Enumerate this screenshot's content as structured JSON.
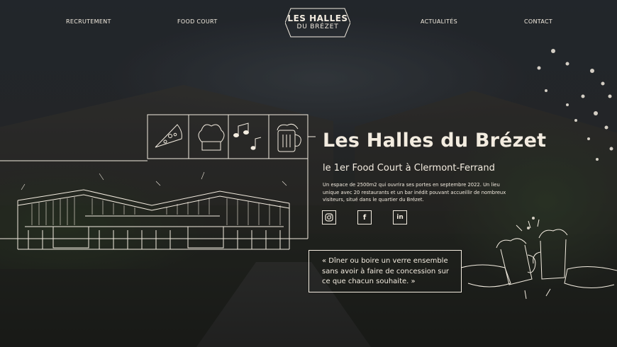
{
  "nav": {
    "recrutement": "RECRUTEMENT",
    "food_court": "FOOD COURT",
    "actualites": "ACTUALITÉS",
    "contact": "CONTACT"
  },
  "logo": {
    "line1": "LES HALLES",
    "line2": "DU BRÉZET"
  },
  "hero": {
    "title": "Les Halles du Brézet",
    "subtitle": "le 1er Food Court à Clermont-Ferrand",
    "description": "Un espace de 2500m2 qui ouvrira ses portes en septembre 2022. Un lieu unique avec 20 restaurants et un bar inédit pouvant accueillir de nombreux visiteurs, situé dans le quartier du Brézet."
  },
  "social": {
    "instagram_icon": "instagram-icon",
    "facebook_label": "f",
    "linkedin_label": "in"
  },
  "quote": "« Dîner ou boire un verre ensemble sans avoir à faire de concession sur ce que chacun souhaite. »",
  "icons": [
    "pizza-icon",
    "chef-hat-icon",
    "music-notes-icon",
    "beer-mug-icon"
  ],
  "colors": {
    "line": "#f3ece0",
    "bg": "#2a2b26"
  }
}
